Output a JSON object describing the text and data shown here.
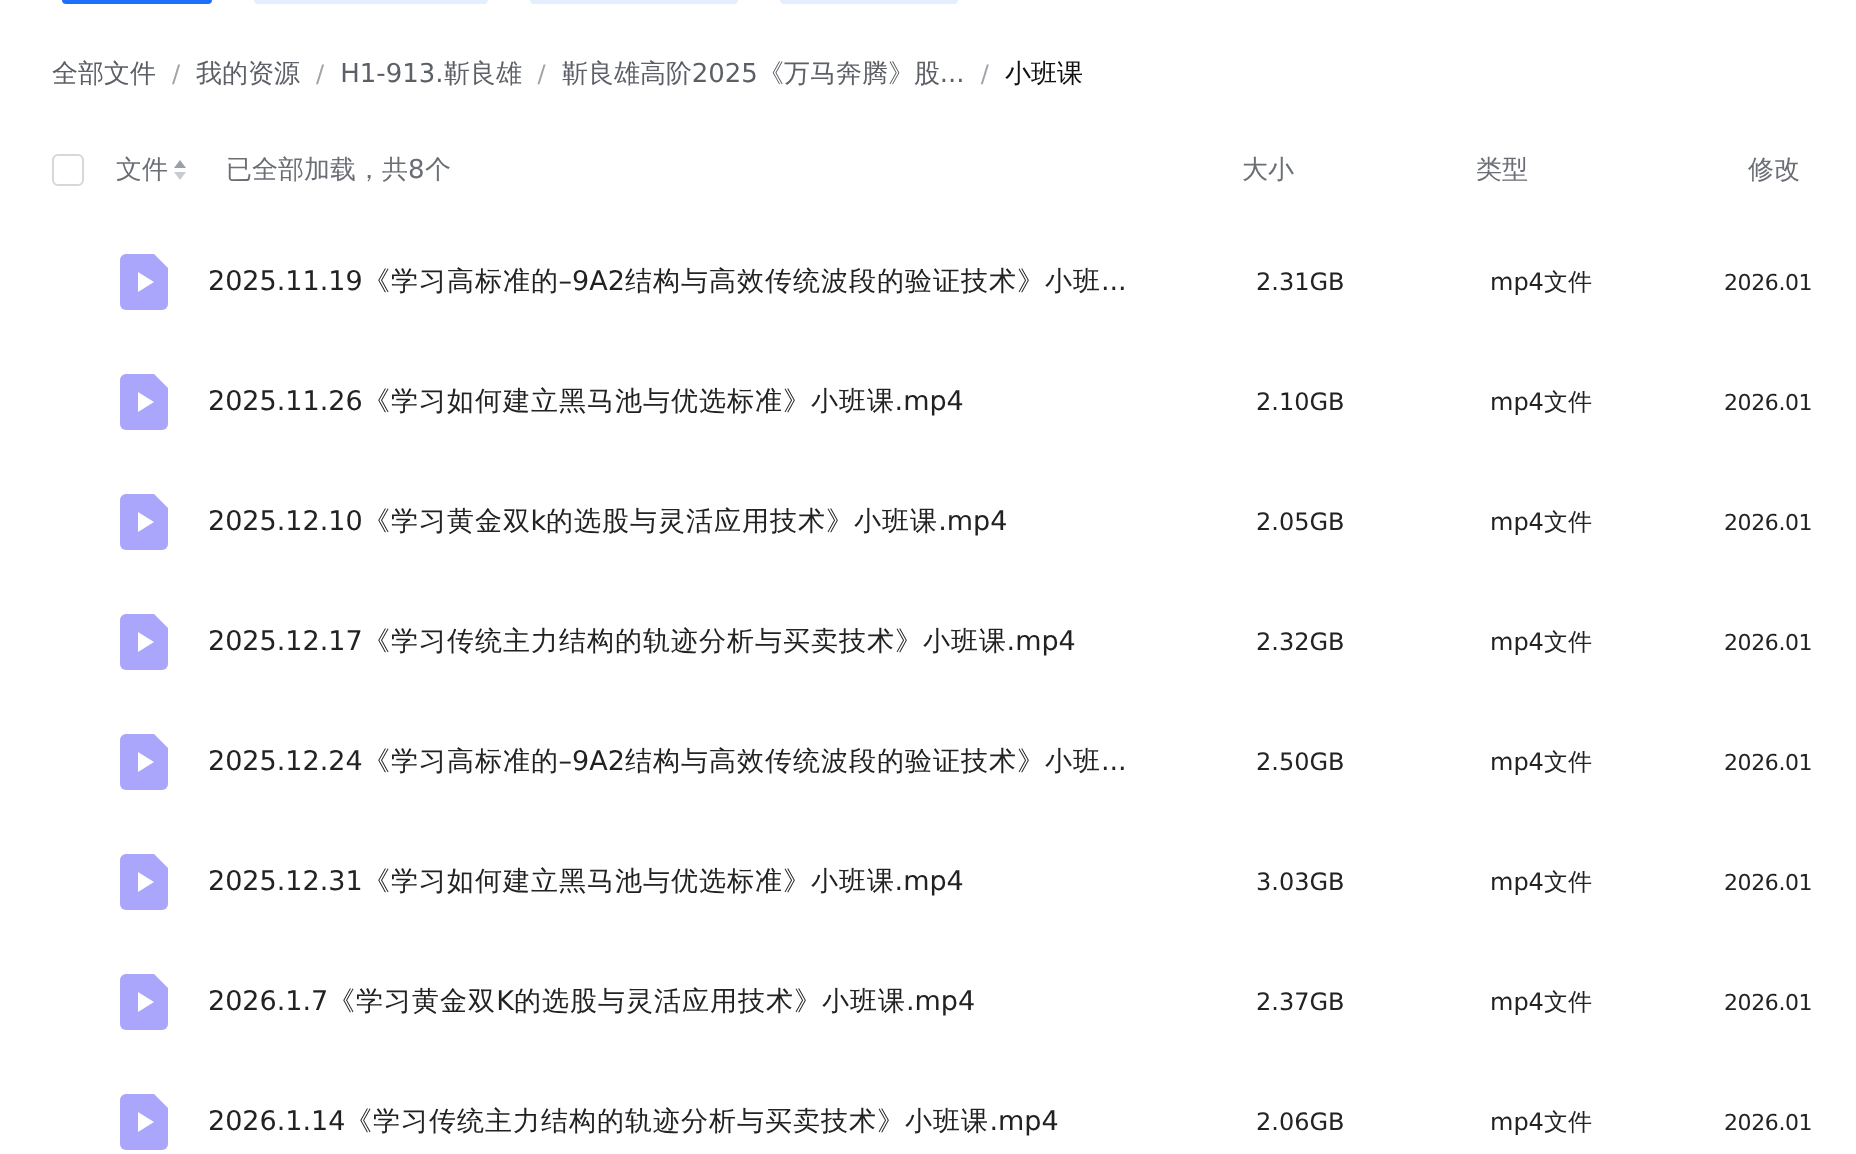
{
  "toolbar": [
    {
      "kind": "primary"
    },
    {
      "kind": "secondary"
    },
    {
      "kind": "secondary"
    },
    {
      "kind": "secondary"
    }
  ],
  "breadcrumb": [
    {
      "label": "全部文件",
      "current": false
    },
    {
      "separator": "/",
      "label": "我的资源",
      "current": false
    },
    {
      "separator": "/",
      "label": "H1-913.靳良雄",
      "current": false
    },
    {
      "separator": "/",
      "label": "靳良雄高阶2025《万马奔腾》股...",
      "current": false
    },
    {
      "separator": "/",
      "label": "小班课",
      "current": true
    }
  ],
  "header": {
    "select_all": {
      "checked": false
    },
    "name_label": "文件",
    "status": "已全部加载，共8个",
    "columns": [
      "大小",
      "类型",
      "修改"
    ]
  },
  "files": [
    {
      "name": "2025.11.19《学习高标准的–9A2结构与高效传统波段的验证技术》小班...",
      "size": "2.31GB",
      "type": "mp4文件",
      "modified": "2026.01"
    },
    {
      "name": "2025.11.26《学习如何建立黑马池与优选标准》小班课.mp4",
      "size": "2.10GB",
      "type": "mp4文件",
      "modified": "2026.01"
    },
    {
      "name": "2025.12.10《学习黄金双k的选股与灵活应用技术》小班课.mp4",
      "size": "2.05GB",
      "type": "mp4文件",
      "modified": "2026.01"
    },
    {
      "name": "2025.12.17《学习传统主力结构的轨迹分析与买卖技术》小班课.mp4",
      "size": "2.32GB",
      "type": "mp4文件",
      "modified": "2026.01"
    },
    {
      "name": "2025.12.24《学习高标准的–9A2结构与高效传统波段的验证技术》小班...",
      "size": "2.50GB",
      "type": "mp4文件",
      "modified": "2026.01"
    },
    {
      "name": "2025.12.31《学习如何建立黑马池与优选标准》小班课.mp4",
      "size": "3.03GB",
      "type": "mp4文件",
      "modified": "2026.01"
    },
    {
      "name": "2026.1.7《学习黄金双K的选股与灵活应用技术》小班课.mp4",
      "size": "2.37GB",
      "type": "mp4文件",
      "modified": "2026.01"
    },
    {
      "name": "2026.1.14《学习传统主力结构的轨迹分析与买卖技术》小班课.mp4",
      "size": "2.06GB",
      "type": "mp4文件",
      "modified": "2026.01"
    }
  ]
}
